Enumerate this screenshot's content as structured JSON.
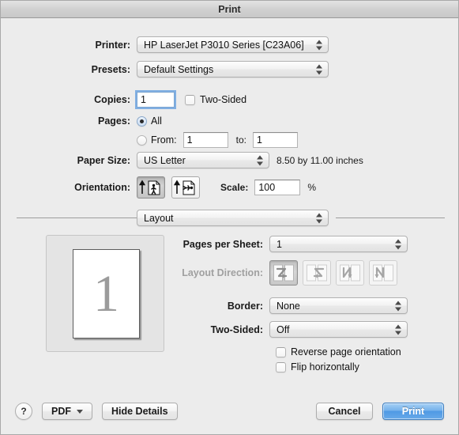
{
  "window": {
    "title": "Print"
  },
  "settings": {
    "printer_label": "Printer:",
    "printer_value": "HP LaserJet P3010 Series [C23A06]",
    "presets_label": "Presets:",
    "presets_value": "Default Settings",
    "copies_label": "Copies:",
    "copies_value": "1",
    "two_sided_checkbox_label": "Two-Sided",
    "pages_label": "Pages:",
    "pages_all_label": "All",
    "pages_from_label": "From:",
    "pages_from_value": "1",
    "pages_to_label": "to:",
    "pages_to_value": "1",
    "paper_size_label": "Paper Size:",
    "paper_size_value": "US Letter",
    "paper_dimensions": "8.50 by 11.00 inches",
    "orientation_label": "Orientation:",
    "orientation_portrait_name": "portrait",
    "orientation_landscape_name": "landscape",
    "orientation_selected": "portrait",
    "scale_label": "Scale:",
    "scale_value": "100",
    "scale_unit": "%"
  },
  "pane": {
    "selector_value": "Layout",
    "pages_per_sheet_label": "Pages per Sheet:",
    "pages_per_sheet_value": "1",
    "layout_direction_label": "Layout Direction:",
    "layout_direction_enabled": false,
    "layout_direction_options": [
      "across-then-down",
      "down-then-across-reverse",
      "down-then-across",
      "across-then-down-reverse"
    ],
    "layout_direction_selected_index": 0,
    "border_label": "Border:",
    "border_value": "None",
    "two_sided_label": "Two-Sided:",
    "two_sided_value": "Off",
    "reverse_page_orientation_label": "Reverse page orientation",
    "reverse_page_orientation_checked": false,
    "flip_horizontally_label": "Flip horizontally",
    "flip_horizontally_checked": false
  },
  "preview": {
    "page_number": "1"
  },
  "footer": {
    "help_label": "?",
    "pdf_label": "PDF",
    "hide_details_label": "Hide Details",
    "cancel_label": "Cancel",
    "print_label": "Print"
  },
  "colors": {
    "window_bg": "#ececec",
    "accent_blue": "#4f99e4",
    "disabled_text": "#a0a0a0",
    "separator": "#9d9d9d"
  }
}
